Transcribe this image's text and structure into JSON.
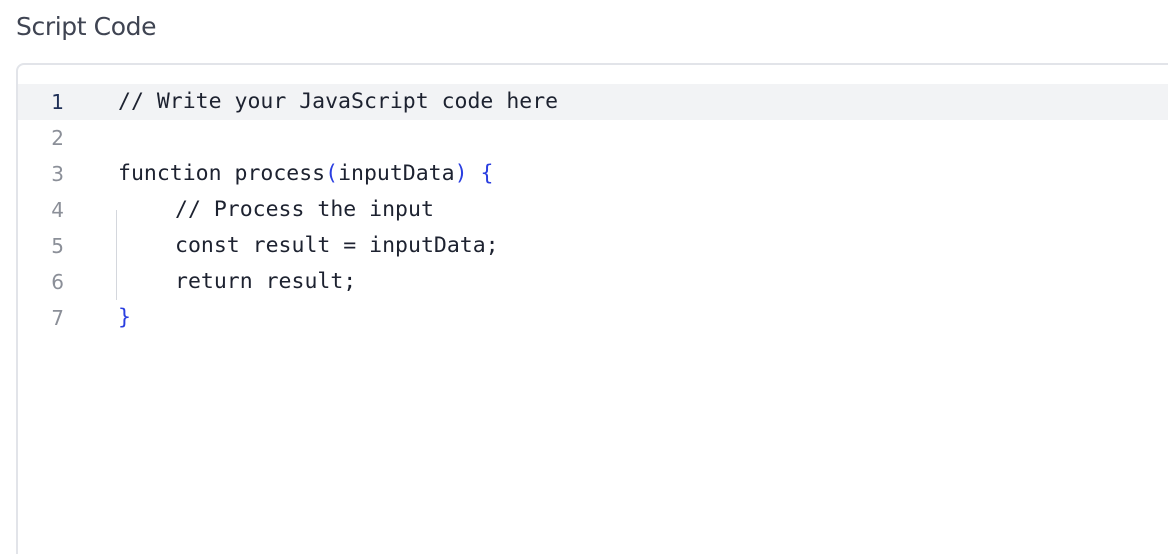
{
  "title": "Script Code",
  "editor": {
    "active_line": 1,
    "lines": [
      {
        "number": "1",
        "text": "// Write your JavaScript code here"
      },
      {
        "number": "2",
        "text": ""
      },
      {
        "number": "3",
        "text_pre": "function process",
        "paren_open": "(",
        "param": "inputData",
        "paren_close": ")",
        "space": " ",
        "brace_open": "{"
      },
      {
        "number": "4",
        "text": "// Process the input"
      },
      {
        "number": "5",
        "text": "const result = inputData;"
      },
      {
        "number": "6",
        "text": "return result;"
      },
      {
        "number": "7",
        "brace_close": "}"
      }
    ]
  },
  "colors": {
    "bracket": "#2a3ee0",
    "active_line_bg": "#f2f3f5",
    "text": "#1d2230"
  }
}
